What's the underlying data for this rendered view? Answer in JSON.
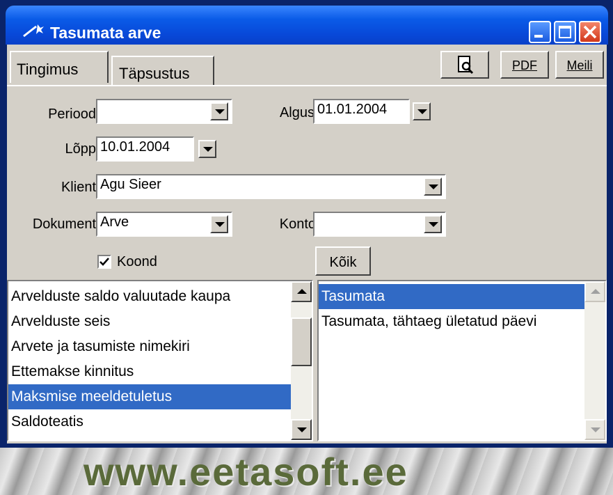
{
  "window": {
    "title": "Tasumata arve",
    "title_icon": "wand-icon"
  },
  "tabs": [
    {
      "label": "Tingimus"
    },
    {
      "label": "Täpsustus"
    }
  ],
  "toolbar": {
    "pdf_label": "PDF",
    "mail_label": "Meili",
    "preview_icon": "print-preview-icon"
  },
  "form": {
    "period_label": "Periood",
    "period_value": "",
    "start_label": "Algus",
    "start_value": "01.01.2004",
    "end_label": "Lõpp",
    "end_value": "10.01.2004",
    "client_label": "Klient",
    "client_value": "Agu Sieer",
    "document_label": "Dokument",
    "document_value": "Arve",
    "account_label": "Konto",
    "account_value": "",
    "summary_label": "Koond",
    "summary_checked": true,
    "all_label": "Kõik"
  },
  "reports": {
    "items": [
      "Arvelduste saldo valuutade kaupa",
      "Arvelduste seis",
      "Arvete ja tasumiste nimekiri",
      "Ettemakse kinnitus",
      "Maksmise meeldetuletus",
      "Saldoteatis"
    ],
    "selected": 4
  },
  "subreports": {
    "items": [
      "Tasumata",
      "Tasumata, tähtaeg ületatud päevi"
    ],
    "selected": 0
  },
  "banner": {
    "text": "www.eetasoft.ee"
  },
  "colors": {
    "titlebar": "#0a5be7",
    "selection": "#316ac5",
    "face": "#d4d0c8"
  }
}
